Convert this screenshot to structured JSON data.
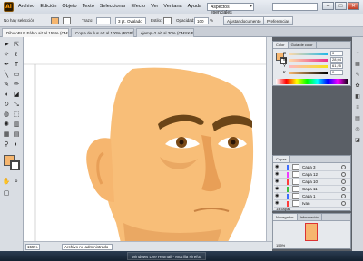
{
  "menubar": {
    "app_logo": "Ai",
    "items": [
      "Archivo",
      "Edición",
      "Objeto",
      "Texto",
      "Seleccionar",
      "Efecto",
      "Ver",
      "Ventana",
      "Ayuda"
    ],
    "workspace": "Aspectos esenciales"
  },
  "control_bar": {
    "selection": "No hay selección",
    "stroke_label": "Trazo:",
    "brush_preset": "3 pt. Ovalado",
    "style_label": "Estilo:",
    "opacity_label": "Opacidad:",
    "opacity_value": "100",
    "opacity_unit": "%",
    "doc_setup_button": "Ajustar documento",
    "prefs_button": "Preferencias"
  },
  "tabs": [
    {
      "label": "DibujoBLE Fábio.ai* al 155% (CMYK/Previsualizar)",
      "active": true
    },
    {
      "label": "Copia de ilus.ai* al 100% (RGB/Previsualizar)",
      "active": false
    },
    {
      "label": "ejempl-2.ai* al 30% (CMYK/Previsualizar)",
      "active": false
    }
  ],
  "colors": {
    "fill": "#f6b66f",
    "skin": "#f8be78",
    "skin_shade": "#e89f57",
    "brow": "#6b4518",
    "iris": "#7a4a17"
  },
  "color_panel": {
    "tabs": [
      "Color",
      "Guía de color"
    ],
    "channels": [
      {
        "label": "C",
        "value": "0",
        "unit": "%",
        "gradient": "linear-gradient(90deg,#ffd9a8,#22b8e8)"
      },
      {
        "label": "M",
        "value": "28,94",
        "unit": "%",
        "gradient": "linear-gradient(90deg,#ffd9a8,#e8308c)"
      },
      {
        "label": "Y",
        "value": "61,25",
        "unit": "%",
        "gradient": "linear-gradient(90deg,#ffb6c1,#f7e21a)"
      },
      {
        "label": "K",
        "value": "0",
        "unit": "%",
        "gradient": "linear-gradient(90deg,#f6b66f,#000000)"
      }
    ]
  },
  "layers_panel": {
    "tab": "Capas",
    "layers": [
      {
        "name": "Capa 3",
        "color": "#3c6cff"
      },
      {
        "name": "Capa 12",
        "color": "#f03cff"
      },
      {
        "name": "Capa 10",
        "color": "#ff3c3c"
      },
      {
        "name": "Capa 11",
        "color": "#3cbf3c"
      },
      {
        "name": "Capa 1",
        "color": "#3c6cff"
      },
      {
        "name": "Ivan",
        "color": "#ff3c3c"
      }
    ],
    "count": "14 capas"
  },
  "navigator_panel": {
    "tabs": [
      "Navegador",
      "Información"
    ],
    "zoom": "155%"
  },
  "status": {
    "zoom": "155%",
    "message": "Archivo no administrado"
  },
  "taskbar": {
    "items": [
      "Windows Live Hotmail - Mozilla Firefox"
    ]
  }
}
